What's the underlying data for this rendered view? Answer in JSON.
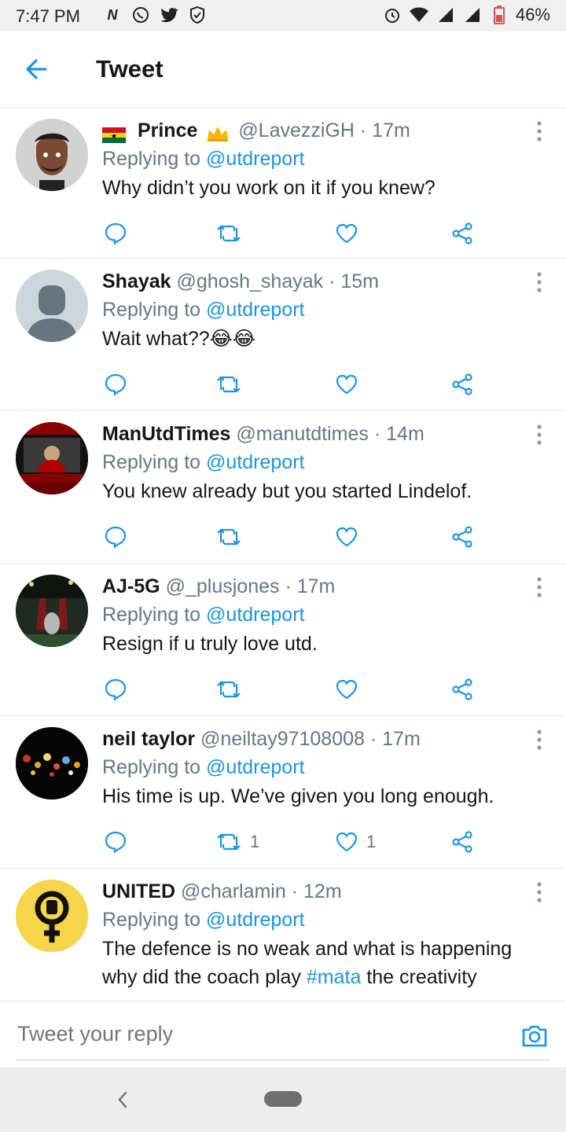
{
  "status_bar": {
    "time": "7:47 PM",
    "battery": "46%",
    "icons": [
      "netflix-icon",
      "whatsapp-icon",
      "twitter-icon",
      "shield-icon",
      "alarm-icon",
      "wifi-icon",
      "signal-icon",
      "signal-icon",
      "battery-icon"
    ]
  },
  "header": {
    "title": "Tweet"
  },
  "colors": {
    "link": "#1b95e0",
    "muted": "#657786",
    "text": "#14171a",
    "border": "#e1e8ed"
  },
  "tweets": [
    {
      "name": "Prince",
      "handle": "@LavezziGH",
      "time": "· 17m",
      "replying_label": "Replying to",
      "replying_to": "@utdreport",
      "text": "Why didn’t you work on it if you knew?",
      "retweets": "",
      "likes": ""
    },
    {
      "name": "Shayak",
      "handle": "@ghosh_shayak",
      "time": "· 15m",
      "replying_label": "Replying to",
      "replying_to": "@utdreport",
      "text": "Wait what??😂😂",
      "retweets": "",
      "likes": ""
    },
    {
      "name": "ManUtdTimes",
      "handle": "@manutdtimes",
      "time": "· 14m",
      "replying_label": "Replying to",
      "replying_to": "@utdreport",
      "text": "You knew already but you started Lindelof.",
      "retweets": "",
      "likes": ""
    },
    {
      "name": "AJ-5G",
      "handle": "@_plusjones",
      "time": "· 17m",
      "replying_label": "Replying to",
      "replying_to": "@utdreport",
      "text": "Resign if u truly love utd.",
      "retweets": "",
      "likes": ""
    },
    {
      "name": "neil taylor",
      "handle": "@neiltay97108008",
      "time": "· 17m",
      "replying_label": "Replying to",
      "replying_to": "@utdreport",
      "text": "His time is up. We’ve given you long enough.",
      "retweets": "1",
      "likes": "1"
    },
    {
      "name": "UNITED",
      "handle": "@charlamin",
      "time": "· 12m",
      "replying_label": "Replying to",
      "replying_to": "@utdreport",
      "text_before": "The defence is no weak and what is happening why did the coach play ",
      "hashtag": "#mata",
      "text_after": " the creativity"
    }
  ],
  "compose": {
    "placeholder": "Tweet your reply"
  }
}
